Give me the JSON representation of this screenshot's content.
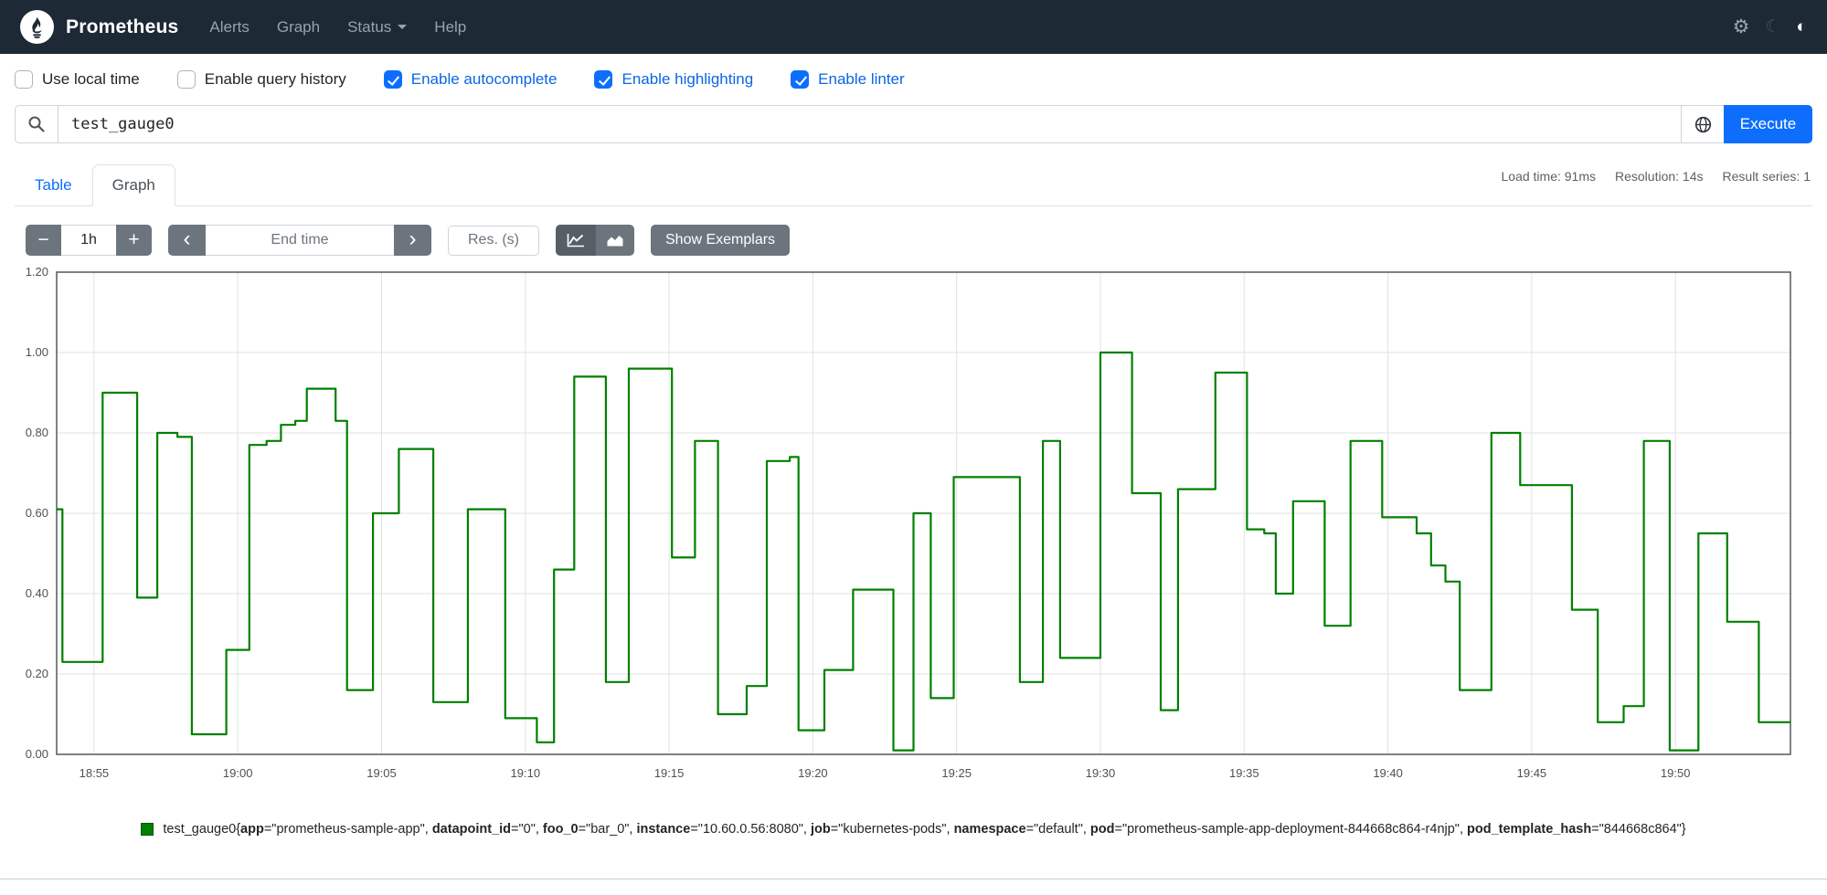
{
  "navbar": {
    "brand": "Prometheus",
    "links": [
      {
        "label": "Alerts"
      },
      {
        "label": "Graph"
      },
      {
        "label": "Status"
      },
      {
        "label": "Help"
      }
    ],
    "icons": {
      "settings": "⚙",
      "moon": "☾",
      "contrast": "◐"
    }
  },
  "options": [
    {
      "label": "Use local time",
      "checked": false
    },
    {
      "label": "Enable query history",
      "checked": false
    },
    {
      "label": "Enable autocomplete",
      "checked": true
    },
    {
      "label": "Enable highlighting",
      "checked": true
    },
    {
      "label": "Enable linter",
      "checked": true
    }
  ],
  "query": {
    "value": "test_gauge0",
    "execute_label": "Execute"
  },
  "tabs": [
    {
      "label": "Table",
      "active": false
    },
    {
      "label": "Graph",
      "active": true
    }
  ],
  "stats": {
    "load_time": "Load time: 91ms",
    "resolution": "Resolution: 14s",
    "result_series": "Result series: 1"
  },
  "controls": {
    "minus_label": "−",
    "plus_label": "+",
    "range_value": "1h",
    "prev_label": "‹",
    "next_label": "›",
    "end_time_placeholder": "End time",
    "res_placeholder": "Res. (s)",
    "show_exemplars_label": "Show Exemplars"
  },
  "chart_data": {
    "type": "line",
    "step": true,
    "title": "",
    "xlabel": "",
    "ylabel": "",
    "grid": true,
    "x_domain": [
      0,
      60.3
    ],
    "ylim": [
      0,
      1.2
    ],
    "x_unit": "minutes from 18:53.7 (clock time HH:MM)",
    "xticks": [
      {
        "t": 1.3,
        "label": "18:55"
      },
      {
        "t": 6.3,
        "label": "19:00"
      },
      {
        "t": 11.3,
        "label": "19:05"
      },
      {
        "t": 16.3,
        "label": "19:10"
      },
      {
        "t": 21.3,
        "label": "19:15"
      },
      {
        "t": 26.3,
        "label": "19:20"
      },
      {
        "t": 31.3,
        "label": "19:25"
      },
      {
        "t": 36.3,
        "label": "19:30"
      },
      {
        "t": 41.3,
        "label": "19:35"
      },
      {
        "t": 46.3,
        "label": "19:40"
      },
      {
        "t": 51.3,
        "label": "19:45"
      },
      {
        "t": 56.3,
        "label": "19:50"
      }
    ],
    "yticks": [
      {
        "v": 0.0,
        "label": "0.00"
      },
      {
        "v": 0.2,
        "label": "0.20"
      },
      {
        "v": 0.4,
        "label": "0.40"
      },
      {
        "v": 0.6,
        "label": "0.60"
      },
      {
        "v": 0.8,
        "label": "0.80"
      },
      {
        "v": 1.0,
        "label": "1.00"
      },
      {
        "v": 1.2,
        "label": "1.20"
      }
    ],
    "series": [
      {
        "name": "test_gauge0",
        "color": "#008000",
        "points": [
          [
            0.0,
            0.61
          ],
          [
            0.2,
            0.23
          ],
          [
            1.6,
            0.9
          ],
          [
            2.8,
            0.39
          ],
          [
            3.5,
            0.8
          ],
          [
            4.2,
            0.79
          ],
          [
            4.7,
            0.05
          ],
          [
            5.9,
            0.26
          ],
          [
            6.7,
            0.77
          ],
          [
            7.3,
            0.78
          ],
          [
            7.8,
            0.82
          ],
          [
            8.3,
            0.83
          ],
          [
            8.7,
            0.91
          ],
          [
            9.7,
            0.83
          ],
          [
            10.1,
            0.16
          ],
          [
            11.0,
            0.6
          ],
          [
            11.9,
            0.76
          ],
          [
            13.1,
            0.13
          ],
          [
            14.3,
            0.61
          ],
          [
            15.6,
            0.09
          ],
          [
            16.7,
            0.03
          ],
          [
            17.3,
            0.46
          ],
          [
            18.0,
            0.94
          ],
          [
            19.1,
            0.18
          ],
          [
            19.9,
            0.96
          ],
          [
            21.4,
            0.49
          ],
          [
            22.2,
            0.78
          ],
          [
            23.0,
            0.1
          ],
          [
            24.0,
            0.17
          ],
          [
            24.7,
            0.73
          ],
          [
            25.5,
            0.74
          ],
          [
            25.8,
            0.06
          ],
          [
            26.7,
            0.21
          ],
          [
            27.7,
            0.41
          ],
          [
            29.1,
            0.01
          ],
          [
            29.8,
            0.6
          ],
          [
            30.4,
            0.14
          ],
          [
            31.2,
            0.69
          ],
          [
            33.5,
            0.18
          ],
          [
            34.3,
            0.78
          ],
          [
            34.9,
            0.24
          ],
          [
            36.3,
            1.0
          ],
          [
            37.4,
            0.65
          ],
          [
            38.4,
            0.11
          ],
          [
            39.0,
            0.66
          ],
          [
            40.3,
            0.95
          ],
          [
            41.4,
            0.56
          ],
          [
            42.0,
            0.55
          ],
          [
            42.4,
            0.4
          ],
          [
            43.0,
            0.63
          ],
          [
            44.1,
            0.32
          ],
          [
            45.0,
            0.78
          ],
          [
            46.1,
            0.59
          ],
          [
            47.3,
            0.55
          ],
          [
            47.8,
            0.47
          ],
          [
            48.3,
            0.43
          ],
          [
            48.8,
            0.16
          ],
          [
            49.9,
            0.8
          ],
          [
            50.9,
            0.67
          ],
          [
            52.7,
            0.36
          ],
          [
            53.6,
            0.08
          ],
          [
            54.5,
            0.12
          ],
          [
            55.2,
            0.78
          ],
          [
            56.1,
            0.01
          ],
          [
            57.1,
            0.55
          ],
          [
            58.1,
            0.33
          ],
          [
            59.2,
            0.08
          ]
        ]
      }
    ]
  },
  "legend": {
    "swatch_color": "#008000",
    "metric": "test_gauge0",
    "labels": [
      {
        "key": "app",
        "value": "prometheus-sample-app"
      },
      {
        "key": "datapoint_id",
        "value": "0"
      },
      {
        "key": "foo_0",
        "value": "bar_0"
      },
      {
        "key": "instance",
        "value": "10.60.0.56:8080"
      },
      {
        "key": "job",
        "value": "kubernetes-pods"
      },
      {
        "key": "namespace",
        "value": "default"
      },
      {
        "key": "pod",
        "value": "prometheus-sample-app-deployment-844668c864-r4njp"
      },
      {
        "key": "pod_template_hash",
        "value": "844668c864"
      }
    ]
  }
}
